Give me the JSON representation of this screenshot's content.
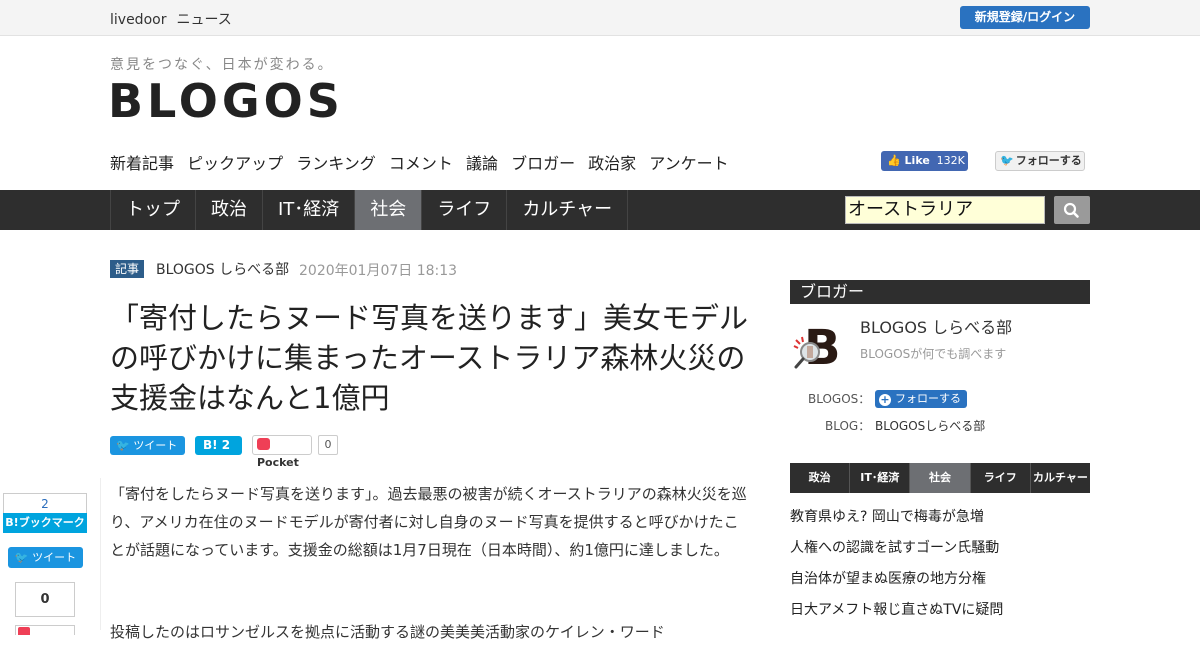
{
  "topbar": {
    "brand1": "livedoor",
    "brand2": "ニュース",
    "login": "新規登録/ログイン"
  },
  "header": {
    "tagline": "意見をつなぐ、日本が変わる。",
    "logo": "BLOGOS",
    "subnav": [
      "新着記事",
      "ピックアップ",
      "ランキング",
      "コメント",
      "議論",
      "ブロガー",
      "政治家",
      "アンケート"
    ],
    "fb_like": "Like",
    "fb_count": "132K",
    "tw_follow": "フォローする"
  },
  "mainnav": {
    "tabs": [
      {
        "label": "トップ",
        "active": false
      },
      {
        "label": "政治",
        "active": false
      },
      {
        "label": "IT･経済",
        "active": false
      },
      {
        "label": "社会",
        "active": true
      },
      {
        "label": "ライフ",
        "active": false
      },
      {
        "label": "カルチャー",
        "active": false
      }
    ],
    "search_value": "オーストラリア"
  },
  "article": {
    "tag": "記事",
    "author": "BLOGOS しらべる部",
    "date": "2020年01月07日 18:13",
    "title": "「寄付したらヌード写真を送ります」美女モデルの呼びかけに集まったオーストラリア森林火災の支援金はなんと1億円",
    "tweet": "ツイート",
    "hatena": "B! 2",
    "pocket": "Pocket",
    "pocket_count": "0",
    "body": "「寄付をしたらヌード写真を送ります」。過去最悪の被害が続くオーストラリアの森林火災を巡り、アメリカ在住のヌードモデルが寄付者に対し自身のヌード写真を提供すると呼びかけたことが話題になっています。支援金の総額は1月7日現在（日本時間）、約1億円に達しました。",
    "body2": "投稿したのはロサンゼルスを拠点に活動する謎の美美美活動家のケイレン・ワード"
  },
  "float_share": {
    "hb_count": "2",
    "hb_label": "B!ブックマーク",
    "tweet": "ツイート",
    "count": "0"
  },
  "sidebar": {
    "heading": "ブロガー",
    "blogger_name": "BLOGOS しらべる部",
    "blogger_desc": "BLOGOSが何でも調べます",
    "blogos_label": "BLOGOS：",
    "follow": "フォローする",
    "blog_label": "BLOG：",
    "blog_value": "BLOGOSしらべる部",
    "tabs": [
      {
        "label": "政治",
        "active": false
      },
      {
        "label": "IT･経済",
        "active": false
      },
      {
        "label": "社会",
        "active": true
      },
      {
        "label": "ライフ",
        "active": false
      },
      {
        "label": "カルチャー",
        "active": false
      }
    ],
    "list": [
      "教育県ゆえ? 岡山で梅毒が急増",
      "人権への認識を試すゴーン氏騒動",
      "自治体が望まぬ医療の地方分権",
      "日大アメフト報じ直さぬTVに疑問"
    ]
  }
}
